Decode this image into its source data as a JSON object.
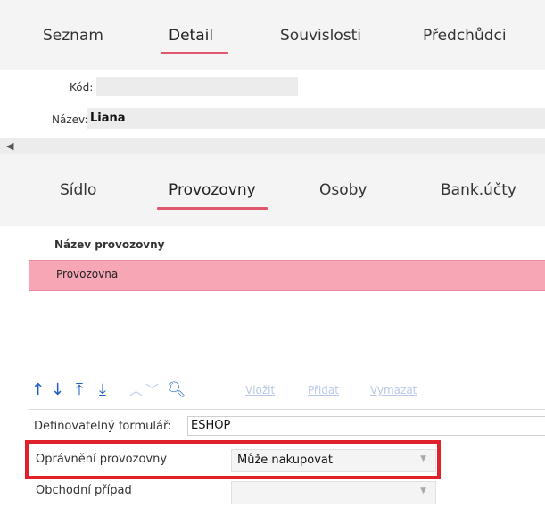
{
  "top_tabs": [
    {
      "label": "Seznam"
    },
    {
      "label": "Detail"
    },
    {
      "label": "Souvislosti"
    },
    {
      "label": "Předchůdci"
    }
  ],
  "header_fields": {
    "kod_label": "Kód:",
    "kod_value": "",
    "nazev_label": "Název:",
    "nazev_value": "Liana"
  },
  "sub_tabs": [
    {
      "label": "Sídlo"
    },
    {
      "label": "Provozovny"
    },
    {
      "label": "Osoby"
    },
    {
      "label": "Bank.účty"
    }
  ],
  "grid": {
    "column_header": "Název provozovny",
    "rows": [
      "Provozovna"
    ]
  },
  "toolbar": {
    "icons": [
      "arrow-up-icon",
      "arrow-down-icon",
      "move-top-icon",
      "move-bottom-icon",
      "chevron-up-icon",
      "chevron-down-icon",
      "search-icon"
    ],
    "vlozit": "Vložit",
    "pridat": "Přidat",
    "vymazat": "Vymazat",
    "active_color": "#1f5fbf",
    "disabled_color": "#b9c9e6"
  },
  "form": {
    "definovatelny_label": "Definovatelný formulář:",
    "definovatelny_value": "ESHOP",
    "opravneni_label": "Oprávnění provozovny",
    "opravneni_value": "Může nakupovat",
    "obchodni_label": "Obchodní případ",
    "obchodni_value": ""
  },
  "colors": {
    "accent": "#e0566d",
    "selected_row": "#f6a6b4",
    "highlight_box": "#e0202a"
  }
}
